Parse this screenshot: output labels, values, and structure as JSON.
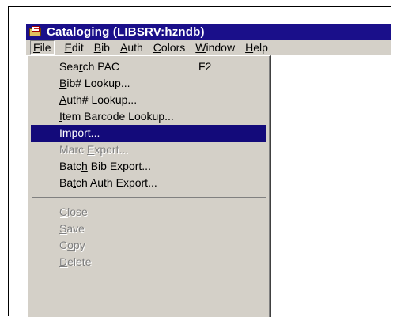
{
  "window": {
    "title": "Cataloging (LIBSRV:hzndb)"
  },
  "menubar": [
    {
      "pre": "",
      "u": "F",
      "post": "ile"
    },
    {
      "pre": "",
      "u": "E",
      "post": "dit"
    },
    {
      "pre": "",
      "u": "B",
      "post": "ib"
    },
    {
      "pre": "",
      "u": "A",
      "post": "uth"
    },
    {
      "pre": "",
      "u": "C",
      "post": "olors"
    },
    {
      "pre": "",
      "u": "W",
      "post": "indow"
    },
    {
      "pre": "",
      "u": "H",
      "post": "elp"
    }
  ],
  "file_menu": [
    {
      "pre": "Sea",
      "u": "r",
      "post": "ch PAC",
      "shortcut": "F2",
      "state": "normal"
    },
    {
      "pre": "",
      "u": "B",
      "post": "ib# Lookup...",
      "shortcut": "",
      "state": "normal"
    },
    {
      "pre": "",
      "u": "A",
      "post": "uth# Lookup...",
      "shortcut": "",
      "state": "normal"
    },
    {
      "pre": "",
      "u": "I",
      "post": "tem Barcode Lookup...",
      "shortcut": "",
      "state": "normal"
    },
    {
      "pre": "I",
      "u": "m",
      "post": "port...",
      "shortcut": "",
      "state": "selected"
    },
    {
      "pre": "Marc ",
      "u": "E",
      "post": "xport...",
      "shortcut": "",
      "state": "disabled"
    },
    {
      "pre": "Batc",
      "u": "h",
      "post": " Bib Export...",
      "shortcut": "",
      "state": "normal"
    },
    {
      "pre": "Ba",
      "u": "t",
      "post": "ch Auth Export...",
      "shortcut": "",
      "state": "normal"
    },
    {
      "pre": "",
      "u": "C",
      "post": "lose",
      "shortcut": "",
      "state": "disabled"
    },
    {
      "pre": "",
      "u": "S",
      "post": "ave",
      "shortcut": "",
      "state": "disabled"
    },
    {
      "pre": "C",
      "u": "o",
      "post": "py",
      "shortcut": "",
      "state": "disabled"
    },
    {
      "pre": "",
      "u": "D",
      "post": "elete",
      "shortcut": "",
      "state": "disabled"
    }
  ]
}
